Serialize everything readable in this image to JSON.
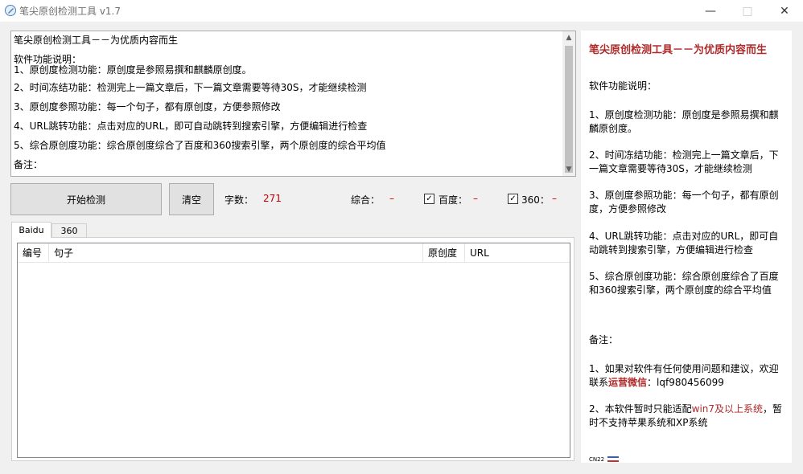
{
  "window": {
    "title": "笔尖原创检测工具 v1.7",
    "minimize_glyph": "—",
    "maximize_glyph": "□",
    "close_glyph": "✕"
  },
  "editor": {
    "lines": [
      "笔尖原创检测工具－－为优质内容而生",
      "软件功能说明：",
      "1、原创度检测功能：原创度是参照易撰和麒麟原创度。",
      "2、时间冻结功能：检测完上一篇文章后，下一篇文章需要等待30S，才能继续检测",
      "3、原创度参照功能：每一个句子，都有原创度，方便参照修改",
      "4、URL跳转功能：点击对应的URL，即可自动跳转到搜索引擎，方便编辑进行检查",
      "5、综合原创度功能：综合原创度综合了百度和360搜索引擎，两个原创度的综合平均值",
      "备注："
    ]
  },
  "toolbar": {
    "start_label": "开始检测",
    "clear_label": "清空",
    "word_count_label": "字数：",
    "word_count_value": "271",
    "overall_label": "综合：",
    "overall_value": "–",
    "baidu_label": "百度：",
    "baidu_value": "–",
    "baidu_checked": true,
    "s360_label": "360：",
    "s360_value": "–",
    "s360_checked": true
  },
  "tabs": [
    {
      "label": "Baidu",
      "active": true
    },
    {
      "label": "360",
      "active": false
    }
  ],
  "table": {
    "columns": [
      "编号",
      "句子",
      "原创度",
      "URL"
    ]
  },
  "info": {
    "title": "笔尖原创检测工具－－为优质内容而生",
    "heading": "软件功能说明：",
    "features": [
      "1、原创度检测功能：原创度是参照易撰和麒麟原创度。",
      "2、时间冻结功能：检测完上一篇文章后，下一篇文章需要等待30S，才能继续检测",
      "3、原创度参照功能：每一个句子，都有原创度，方便参照修改",
      "4、URL跳转功能：点击对应的URL，即可自动跳转到搜索引擎，方便编辑进行检查",
      "5、综合原创度功能：综合原创度综合了百度和360搜索引擎，两个原创度的综合平均值"
    ],
    "notes_heading": "备注：",
    "note1_prefix": "1、如果对软件有任何使用问题和建议，欢迎联系",
    "note1_highlight": "运营微信",
    "note1_suffix": "：lqf980456099",
    "note2_prefix": "2、本软件暂时只能适配",
    "note2_highlight": "win7及以上系统",
    "note2_suffix": "，暂时不支持苹果系统和XP系统",
    "tray_text": "CN22"
  },
  "colors": {
    "accent_red": "#b02a2a",
    "value_red": "#c00000"
  }
}
